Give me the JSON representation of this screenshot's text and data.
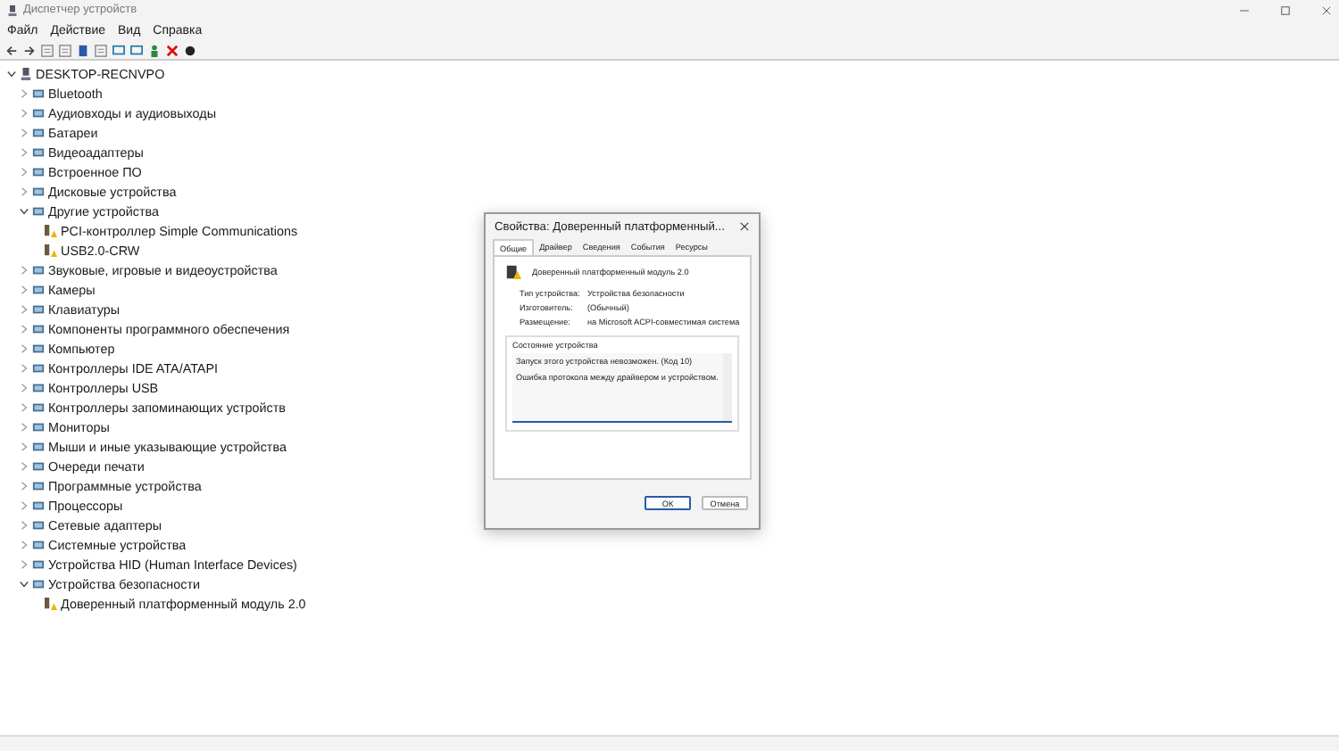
{
  "window": {
    "title": "Диспетчер устройств"
  },
  "menu": [
    "Файл",
    "Действие",
    "Вид",
    "Справка"
  ],
  "tree": {
    "label": "DESKTOP-RECNVPO",
    "expanded": true,
    "children": [
      {
        "label": "Bluetooth",
        "expanded": false
      },
      {
        "label": "Аудиовходы и аудиовыходы",
        "expanded": false
      },
      {
        "label": "Батареи",
        "expanded": false
      },
      {
        "label": "Видеоадаптеры",
        "expanded": false
      },
      {
        "label": "Встроенное ПО",
        "expanded": false
      },
      {
        "label": "Дисковые устройства",
        "expanded": false
      },
      {
        "label": "Другие устройства",
        "expanded": true,
        "children": [
          {
            "label": "PCI-контроллер Simple Communications",
            "problem": true
          },
          {
            "label": "USB2.0-CRW",
            "problem": true
          }
        ]
      },
      {
        "label": "Звуковые, игровые и видеоустройства",
        "expanded": false
      },
      {
        "label": "Камеры",
        "expanded": false
      },
      {
        "label": "Клавиатуры",
        "expanded": false
      },
      {
        "label": "Компоненты программного обеспечения",
        "expanded": false
      },
      {
        "label": "Компьютер",
        "expanded": false
      },
      {
        "label": "Контроллеры IDE ATA/ATAPI",
        "expanded": false
      },
      {
        "label": "Контроллеры USB",
        "expanded": false
      },
      {
        "label": "Контроллеры запоминающих устройств",
        "expanded": false
      },
      {
        "label": "Мониторы",
        "expanded": false
      },
      {
        "label": "Мыши и иные указывающие устройства",
        "expanded": false
      },
      {
        "label": "Очереди печати",
        "expanded": false
      },
      {
        "label": "Программные устройства",
        "expanded": false
      },
      {
        "label": "Процессоры",
        "expanded": false
      },
      {
        "label": "Сетевые адаптеры",
        "expanded": false
      },
      {
        "label": "Системные устройства",
        "expanded": false
      },
      {
        "label": "Устройства HID (Human Interface Devices)",
        "expanded": false
      },
      {
        "label": "Устройства безопасности",
        "expanded": true,
        "children": [
          {
            "label": "Доверенный платформенный модуль 2.0",
            "problem": true
          }
        ]
      }
    ]
  },
  "dialog": {
    "title": "Свойства: Доверенный платформенный...",
    "tabs": [
      {
        "label": "Общие",
        "selected": true
      },
      {
        "label": "Драйвер",
        "selected": false
      },
      {
        "label": "Сведения",
        "selected": false
      },
      {
        "label": "События",
        "selected": false
      },
      {
        "label": "Ресурсы",
        "selected": false
      }
    ],
    "device_name": "Доверенный платформенный модуль 2.0",
    "properties": [
      {
        "label": "Тип устройства:",
        "value": "Устройства безопасности"
      },
      {
        "label": "Изготовитель:",
        "value": "(Обычный)"
      },
      {
        "label": "Размещение:",
        "value": "на Microsoft ACPI-совместимая система"
      }
    ],
    "status_group": "Состояние устройства",
    "status_lines": [
      "Запуск этого устройства невозможен. (Код 10)",
      "Ошибка протокола между драйвером и устройством."
    ],
    "buttons": [
      "ОК",
      "Отмена"
    ]
  }
}
